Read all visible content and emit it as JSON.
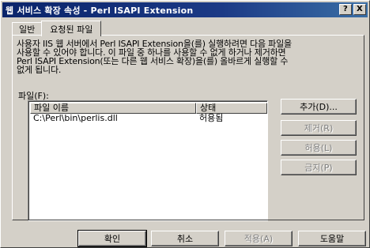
{
  "window": {
    "title": "웹 서비스 확장 속성 - Perl ISAPI Extension",
    "help_button": "?",
    "close_button": "X"
  },
  "tabs": [
    {
      "label": "일반",
      "active": false
    },
    {
      "label": "요청된 파일",
      "active": true
    }
  ],
  "description": "사용자 IIS 웹 서버에서 Perl ISAPI Extension을(를) 실행하려면 다음 파일을\n사용할 수 있어야 합니다. 이 파일 중 하나를 사용할 수 없게 하거나 제거하면\nPerl ISAPI Extension(또는 다른 웹 서비스 확장)을(를) 올바르게 실행할 수\n없게 됩니다.",
  "files_label": "파일(F):",
  "file_list": {
    "columns": [
      "파일 이름",
      "상태"
    ],
    "rows": [
      {
        "name": "C:\\Perl\\bin\\perlis.dll",
        "status": "허용됨"
      }
    ]
  },
  "side_buttons": {
    "add": "추가(D)...",
    "remove": "제거(R)",
    "allow": "허용(L)",
    "prohibit": "금지(P)"
  },
  "dialog_buttons": {
    "ok": "확인",
    "cancel": "취소",
    "apply": "적용(A)",
    "help": "도움말"
  }
}
